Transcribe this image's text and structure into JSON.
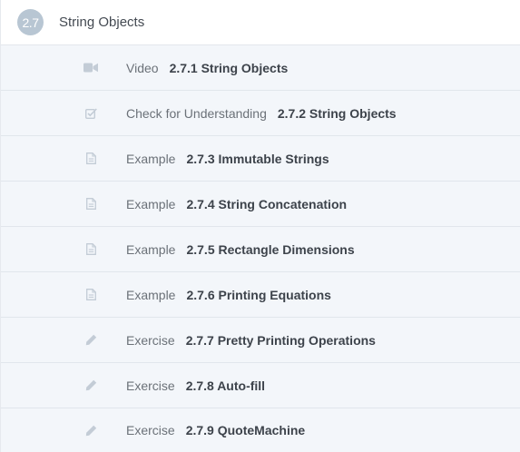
{
  "section": {
    "number": "2.7",
    "title": "String Objects"
  },
  "items": [
    {
      "type": "Video",
      "name": "2.7.1 String Objects",
      "icon": "video-camera-icon"
    },
    {
      "type": "Check for Understanding",
      "name": "2.7.2 String Objects",
      "icon": "checkbox-icon"
    },
    {
      "type": "Example",
      "name": "2.7.3 Immutable Strings",
      "icon": "document-icon"
    },
    {
      "type": "Example",
      "name": "2.7.4 String Concatenation",
      "icon": "document-icon"
    },
    {
      "type": "Example",
      "name": "2.7.5 Rectangle Dimensions",
      "icon": "document-icon"
    },
    {
      "type": "Example",
      "name": "2.7.6 Printing Equations",
      "icon": "document-icon"
    },
    {
      "type": "Exercise",
      "name": "2.7.7 Pretty Printing Operations",
      "icon": "pencil-icon"
    },
    {
      "type": "Exercise",
      "name": "2.7.8 Auto-fill",
      "icon": "pencil-icon"
    },
    {
      "type": "Exercise",
      "name": "2.7.9 QuoteMachine",
      "icon": "pencil-icon"
    }
  ],
  "colors": {
    "badge": "#b8c6d3",
    "icon": "#c3ccd6",
    "row_background": "#f3f6fa"
  }
}
